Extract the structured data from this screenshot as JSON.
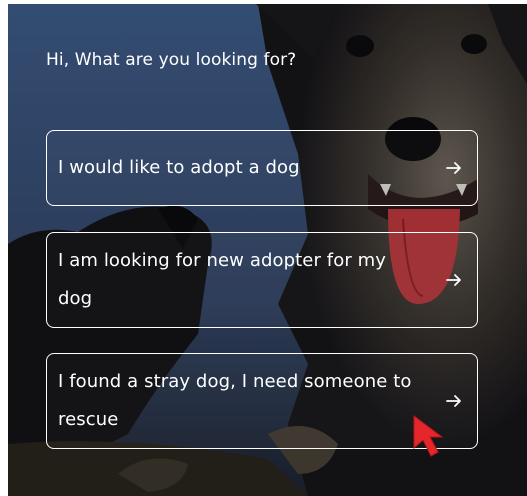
{
  "colors": {
    "sky": "#3c5a86",
    "text": "#ffffff",
    "cursor": "#e5262b"
  },
  "prompt": "Hi, What are you looking for?",
  "options": [
    {
      "label": "I would like to adopt a dog",
      "icon": "arrow-right-icon"
    },
    {
      "label": "I am looking for new adopter for my dog",
      "icon": "arrow-right-icon"
    },
    {
      "label": "I found a stray dog, I need someone to rescue",
      "icon": "arrow-right-icon"
    }
  ]
}
